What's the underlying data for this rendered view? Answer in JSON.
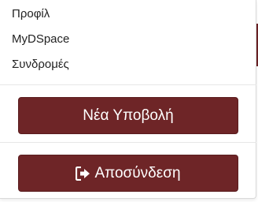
{
  "menu": {
    "items": [
      {
        "label": "Προφίλ"
      },
      {
        "label": "MyDSpace"
      },
      {
        "label": "Συνδρομές"
      }
    ]
  },
  "actions": {
    "new_submission_label": "Νέα Υποβολή",
    "logout_label": "Αποσύνδεση",
    "logout_icon": "sign-out-icon"
  },
  "colors": {
    "button_bg": "#6e2527",
    "button_text": "#ffffff",
    "menu_text": "#222222"
  }
}
